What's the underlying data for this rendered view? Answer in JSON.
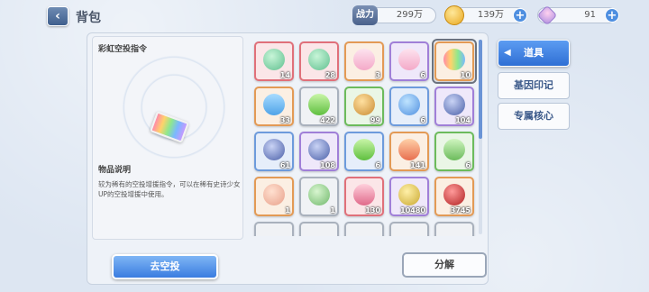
{
  "header": {
    "back_icon": "chevron-left-icon",
    "title": "背包",
    "power_label": "战力",
    "power_value": "299万",
    "coin_value": "139万",
    "gem_value": "91"
  },
  "detail": {
    "item_name": "彩虹空投指令",
    "desc_title": "物品说明",
    "desc_text": "较为稀有的空投增援指令，可以在稀有史诗少女UP的空投增援中使用。"
  },
  "items": [
    {
      "icon": "molecule-icon",
      "rarity": "red",
      "count": "14"
    },
    {
      "icon": "molecule-icon",
      "rarity": "red",
      "count": "28"
    },
    {
      "icon": "ticket-icon",
      "rarity": "orange",
      "count": "3"
    },
    {
      "icon": "ticket-icon",
      "rarity": "purple",
      "count": "6"
    },
    {
      "icon": "rainbow-ticket-icon",
      "rarity": "orange",
      "count": "10"
    },
    {
      "icon": "capsule-icon",
      "rarity": "orange",
      "count": "33"
    },
    {
      "icon": "battery-icon",
      "rarity": "gray",
      "count": "422"
    },
    {
      "icon": "coin-icon",
      "rarity": "green",
      "count": "99"
    },
    {
      "icon": "candy-icon",
      "rarity": "blue",
      "count": "6"
    },
    {
      "icon": "chip-icon",
      "rarity": "purple",
      "count": "104"
    },
    {
      "icon": "chip-icon",
      "rarity": "blue",
      "count": "61"
    },
    {
      "icon": "chip-icon",
      "rarity": "purple",
      "count": "108"
    },
    {
      "icon": "battery-icon",
      "rarity": "blue",
      "count": "6"
    },
    {
      "icon": "crystal-icon",
      "rarity": "orange",
      "count": "141"
    },
    {
      "icon": "bottle-icon",
      "rarity": "green",
      "count": "6"
    },
    {
      "icon": "gift-icon",
      "rarity": "orange",
      "count": "1"
    },
    {
      "icon": "leaf-icon",
      "rarity": "gray",
      "count": "1"
    },
    {
      "icon": "cloth-icon",
      "rarity": "red",
      "count": "130"
    },
    {
      "icon": "trophy-icon",
      "rarity": "purple",
      "count": "10480"
    },
    {
      "icon": "drum-icon",
      "rarity": "orange",
      "count": "3745"
    }
  ],
  "tabs": {
    "active": "道具",
    "tab2": "基因印记",
    "tab3": "专属核心"
  },
  "buttons": {
    "primary": "去空投",
    "secondary": "分解"
  },
  "colors": {
    "red": "#e0707a",
    "orange": "#e39a55",
    "purple": "#a07fd8",
    "green": "#6cbb5c",
    "blue": "#6d9bdc",
    "gray": "#a9b1bd",
    "accent": "#3a7ce0"
  }
}
